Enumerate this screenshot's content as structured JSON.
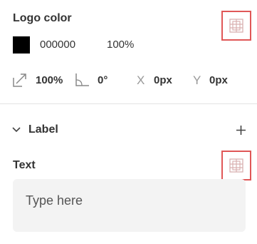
{
  "logo_color": {
    "title": "Logo color",
    "swatch_color": "#000000",
    "hex_value": "000000",
    "opacity": "100%",
    "icon": "logo-placeholder-icon"
  },
  "transform": {
    "scale_value": "100%",
    "scale_icon": "resize-diagonal-icon",
    "rotation_value": "0°",
    "rotation_icon": "angle-icon",
    "x_label": "X",
    "x_value": "0px",
    "y_label": "Y",
    "y_value": "0px"
  },
  "label_section": {
    "title": "Label",
    "toggle_icon": "chevron-down-icon",
    "add_icon": "plus-icon"
  },
  "text_section": {
    "title": "Text",
    "placeholder": "Type here",
    "icon": "logo-placeholder-icon"
  }
}
